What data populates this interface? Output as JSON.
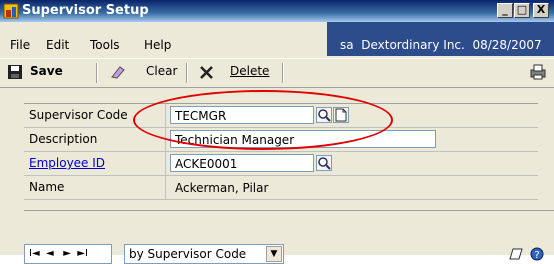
{
  "window": {
    "title": "Supervisor Setup",
    "buttons": [
      "_",
      "□",
      "X"
    ]
  },
  "menu": {
    "items": [
      "File",
      "Edit",
      "Tools",
      "Help"
    ],
    "user_info": "sa  Dextordinary Inc.  08/28/2007"
  },
  "toolbar": {
    "save_label": "Save",
    "clear_label": "Clear",
    "delete_label": "Delete"
  },
  "form": {
    "supervisor_code": {
      "label": "Supervisor Code",
      "value": "TECMGR"
    },
    "description": {
      "label": "Description",
      "value": "Technician Manager"
    },
    "employee_id": {
      "label": "Employee ID",
      "value": "ACKE0001"
    },
    "name": {
      "label": "Name",
      "value": "Ackerman, Pilar"
    }
  },
  "nav": {
    "glyphs": "I◄  ◄   ►  ►I",
    "sort_by": "by Supervisor Code"
  },
  "colors": {
    "titlebar": "#0a246a",
    "accent_link": "#0000cc",
    "highlight_circle": "#e00000"
  }
}
